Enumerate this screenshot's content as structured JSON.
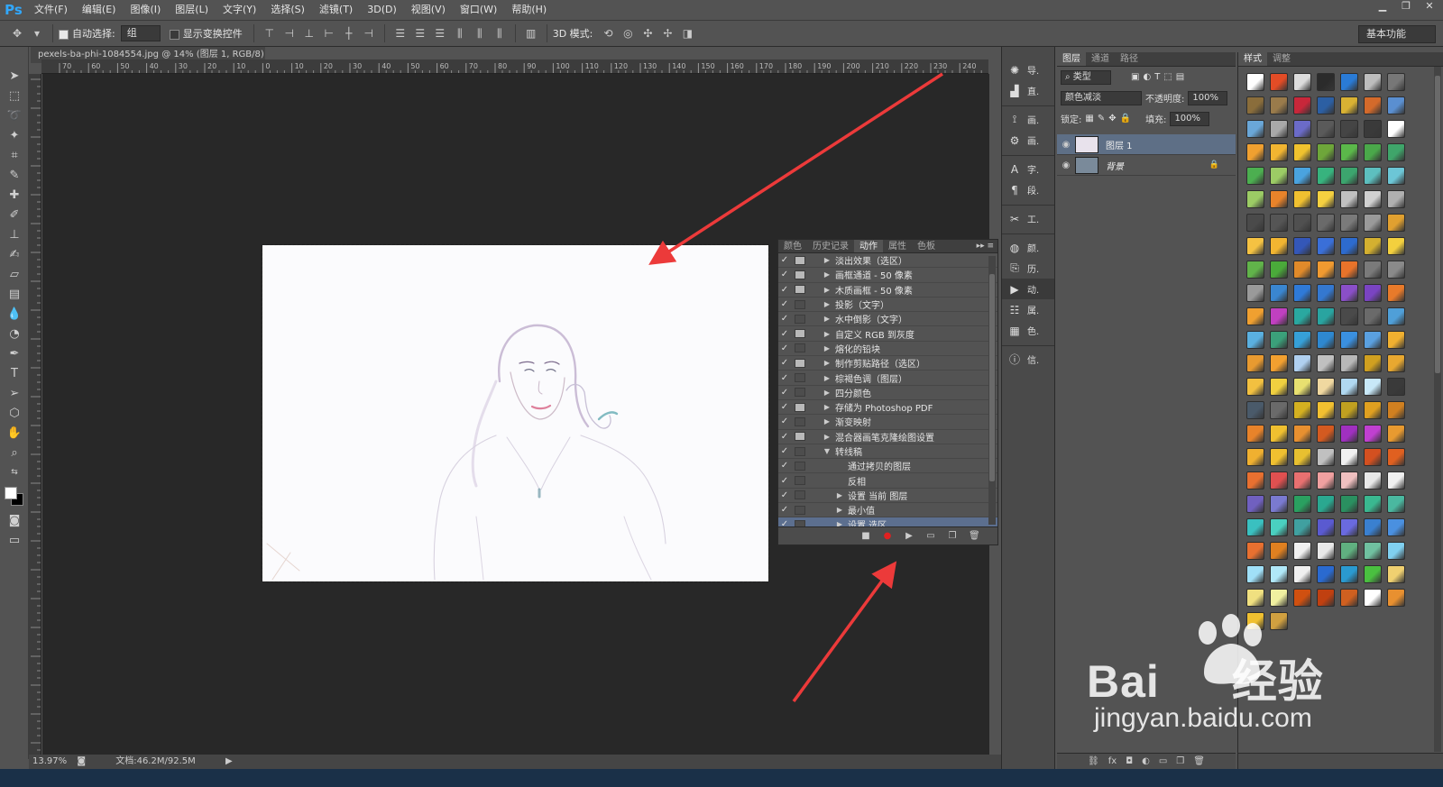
{
  "app": {
    "logo": "Ps"
  },
  "menu": [
    "文件(F)",
    "编辑(E)",
    "图像(I)",
    "图层(L)",
    "文字(Y)",
    "选择(S)",
    "滤镜(T)",
    "3D(D)",
    "视图(V)",
    "窗口(W)",
    "帮助(H)"
  ],
  "options_bar": {
    "auto_select_label": "自动选择:",
    "auto_select_value": "组",
    "show_transform_label": "显示变换控件",
    "mode_3d_label": "3D 模式:",
    "workspace": "基本功能"
  },
  "document": {
    "tab_title": "pexels-ba-phi-1084554.jpg @ 14% (图层 1, RGB/8) *",
    "ruler_ticks": [
      "70",
      "60",
      "50",
      "40",
      "30",
      "20",
      "10",
      "0",
      "10",
      "20",
      "30",
      "40",
      "50",
      "60",
      "70",
      "80",
      "90",
      "100",
      "110",
      "120",
      "130",
      "140",
      "150",
      "160",
      "170",
      "180",
      "190",
      "200",
      "210",
      "220",
      "230",
      "240"
    ]
  },
  "status": {
    "zoom": "13.97%",
    "doc_size": "文档:46.2M/92.5M"
  },
  "actions_panel": {
    "tabs": [
      "颜色",
      "历史记录",
      "动作",
      "属性",
      "色板"
    ],
    "active_tab": "动作",
    "rows": [
      {
        "label": "淡出效果（选区）",
        "checked": true,
        "dialog": true,
        "indent": 0,
        "arrow": "right",
        "selected": false
      },
      {
        "label": "画框通道 - 50 像素",
        "checked": true,
        "dialog": true,
        "indent": 0,
        "arrow": "right",
        "selected": false
      },
      {
        "label": "木质画框 - 50 像素",
        "checked": true,
        "dialog": true,
        "indent": 0,
        "arrow": "right",
        "selected": false
      },
      {
        "label": "投影（文字）",
        "checked": true,
        "dialog": false,
        "indent": 0,
        "arrow": "right",
        "selected": false
      },
      {
        "label": "水中倒影（文字）",
        "checked": true,
        "dialog": false,
        "indent": 0,
        "arrow": "right",
        "selected": false
      },
      {
        "label": "自定义 RGB 到灰度",
        "checked": true,
        "dialog": true,
        "indent": 0,
        "arrow": "right",
        "selected": false
      },
      {
        "label": "熔化的铅块",
        "checked": true,
        "dialog": false,
        "indent": 0,
        "arrow": "right",
        "selected": false
      },
      {
        "label": "制作剪贴路径（选区）",
        "checked": true,
        "dialog": true,
        "indent": 0,
        "arrow": "right",
        "selected": false
      },
      {
        "label": "棕褐色调（图层）",
        "checked": true,
        "dialog": false,
        "indent": 0,
        "arrow": "right",
        "selected": false
      },
      {
        "label": "四分颜色",
        "checked": true,
        "dialog": false,
        "indent": 0,
        "arrow": "right",
        "selected": false
      },
      {
        "label": "存储为 Photoshop PDF",
        "checked": true,
        "dialog": true,
        "indent": 0,
        "arrow": "right",
        "selected": false
      },
      {
        "label": "渐变映射",
        "checked": true,
        "dialog": false,
        "indent": 0,
        "arrow": "right",
        "selected": false
      },
      {
        "label": "混合器画笔克隆绘图设置",
        "checked": true,
        "dialog": true,
        "indent": 0,
        "arrow": "right",
        "selected": false
      },
      {
        "label": "转线稿",
        "checked": true,
        "dialog": false,
        "indent": 0,
        "arrow": "down",
        "selected": false
      },
      {
        "label": "通过拷贝的图层",
        "checked": true,
        "dialog": false,
        "indent": 1,
        "arrow": "none",
        "selected": false
      },
      {
        "label": "反相",
        "checked": true,
        "dialog": false,
        "indent": 1,
        "arrow": "none",
        "selected": false
      },
      {
        "label": "设置 当前 图层",
        "checked": true,
        "dialog": false,
        "indent": 1,
        "arrow": "right",
        "selected": false
      },
      {
        "label": "最小值",
        "checked": true,
        "dialog": false,
        "indent": 1,
        "arrow": "right",
        "selected": false
      },
      {
        "label": "设置 选区",
        "checked": true,
        "dialog": false,
        "indent": 1,
        "arrow": "right",
        "selected": true
      }
    ]
  },
  "dock": [
    {
      "icon": "adjust",
      "label": "导."
    },
    {
      "icon": "histogram",
      "label": "直."
    },
    {
      "icon": "brush-preset",
      "label": "画."
    },
    {
      "icon": "brush",
      "label": "画."
    },
    {
      "icon": "char",
      "label": "字."
    },
    {
      "icon": "para",
      "label": "段."
    },
    {
      "icon": "tool-preset",
      "label": "工."
    },
    {
      "icon": "color",
      "label": "颜."
    },
    {
      "icon": "history",
      "label": "历."
    },
    {
      "icon": "actions",
      "label": "动."
    },
    {
      "icon": "layer-comp",
      "label": "属."
    },
    {
      "icon": "swatch",
      "label": "色."
    },
    {
      "icon": "info",
      "label": "信."
    }
  ],
  "layers_panel": {
    "tabs": [
      "图层",
      "通道",
      "路径"
    ],
    "active_tab": "图层",
    "filter_value": "类型",
    "blend_mode": "颜色减淡",
    "opacity_label": "不透明度:",
    "opacity": "100%",
    "lock_label": "锁定:",
    "fill_label": "填充:",
    "fill": "100%",
    "layers": [
      {
        "name": "图层 1",
        "selected": true,
        "locked": false
      },
      {
        "name": "背景",
        "selected": false,
        "locked": true
      }
    ]
  },
  "styles_panel": {
    "tabs": [
      "样式",
      "调整"
    ],
    "active_tab": "样式",
    "swatch_colors": [
      "#ffffff",
      "#e34c26",
      "#dcdcdc",
      "#2b2b2b",
      "#2a7bd6",
      "#bdbdbd",
      "#777777",
      "#8a6d3b",
      "#9a7b4b",
      "#c8273a",
      "#2c5fa3",
      "#d9b233",
      "#d46a2b",
      "#5a8fd1",
      "#6aa7d8",
      "#a9a9a9",
      "#6b6bc8",
      "#5a5a5a",
      "#454545",
      "#3a3a3a",
      "#ffffff",
      "#f0a030",
      "#f2b531",
      "#f0c22e",
      "#6ea63a",
      "#5bb84a",
      "#4aa84a",
      "#3fa56a",
      "#4caf50",
      "#9ccc65",
      "#4aa3df",
      "#37b37e",
      "#3ca56e",
      "#5dbfbf",
      "#6cc6d6",
      "#9ccc65",
      "#e8832a",
      "#f0c030",
      "#f5d040",
      "#c0c0c0",
      "#d0d0d0",
      "#b0b0b0",
      "#4a4a4a",
      "#555555",
      "#505050",
      "#6a6a6a",
      "#7a7a7a",
      "#9a9a9a",
      "#e0a030",
      "#f5c242",
      "#f2b531",
      "#3457b8",
      "#3a6fd8",
      "#2d6bcf",
      "#d4b030",
      "#f3d03e",
      "#61b34a",
      "#4aaa3a",
      "#e08a2a",
      "#f09a30",
      "#e8732a",
      "#7a7a7a",
      "#8a8a8a",
      "#9a9a9a",
      "#3a86d0",
      "#2f7ad8",
      "#3478d0",
      "#8a4fc8",
      "#7a44c2",
      "#e87a2a",
      "#f0a030",
      "#c040c0",
      "#2aa8a0",
      "#29a4a0",
      "#4a4a4a",
      "#6a6a6a",
      "#4f9fd8",
      "#5ab0e0",
      "#3ba07a",
      "#36a0d8",
      "#2e88d0",
      "#3a90e0",
      "#5aa0e0",
      "#f0b030",
      "#e89a30",
      "#f2a030",
      "#b0d0f0",
      "#c0c0c0",
      "#b8b8b8",
      "#d0a020",
      "#e8a830",
      "#f2c040",
      "#f0d040",
      "#e8e070",
      "#f0d8a0",
      "#b0d8f0",
      "#c8e8f8",
      "#3a3a3a",
      "#4a5a6a",
      "#6a6a6a",
      "#d4b020",
      "#f2c030",
      "#c0a020",
      "#e0a020",
      "#d08020",
      "#e8832a",
      "#f0c030",
      "#e89030",
      "#d45a20",
      "#a030c0",
      "#c040d0",
      "#e89a30",
      "#f0b030",
      "#f0c030",
      "#e8c030",
      "#c0c0c0",
      "#f0f0f0",
      "#d45020",
      "#e06020",
      "#e87030",
      "#e05050",
      "#e87070",
      "#f0a0a0",
      "#f0c0c0",
      "#e8e8e8",
      "#f0f0f0",
      "#7060c0",
      "#7a7ad0",
      "#2aa060",
      "#2aa890",
      "#2a9060",
      "#3ab890",
      "#4ab8a0",
      "#3ac0c0",
      "#4ad0c0",
      "#40a0a0",
      "#5a5ad0",
      "#6a6ae0",
      "#3a80d0",
      "#4a90e0",
      "#e87030",
      "#e08020",
      "#f0f0f0",
      "#e8e8e8",
      "#60b080",
      "#70c0a0",
      "#80d0f0",
      "#a0e0f8",
      "#b0e8f8",
      "#f0f0f0",
      "#2a6ad0",
      "#2a9ad0",
      "#4ac040",
      "#f0d070",
      "#f0e080",
      "#f0f0a0",
      "#d05010",
      "#c04010",
      "#d06020",
      "#ffffff",
      "#e89030",
      "#f0c030",
      "#d0a040"
    ]
  },
  "watermark": {
    "brand": "Bai",
    "cn": "经验",
    "url": "jingyan.baidu.com"
  }
}
